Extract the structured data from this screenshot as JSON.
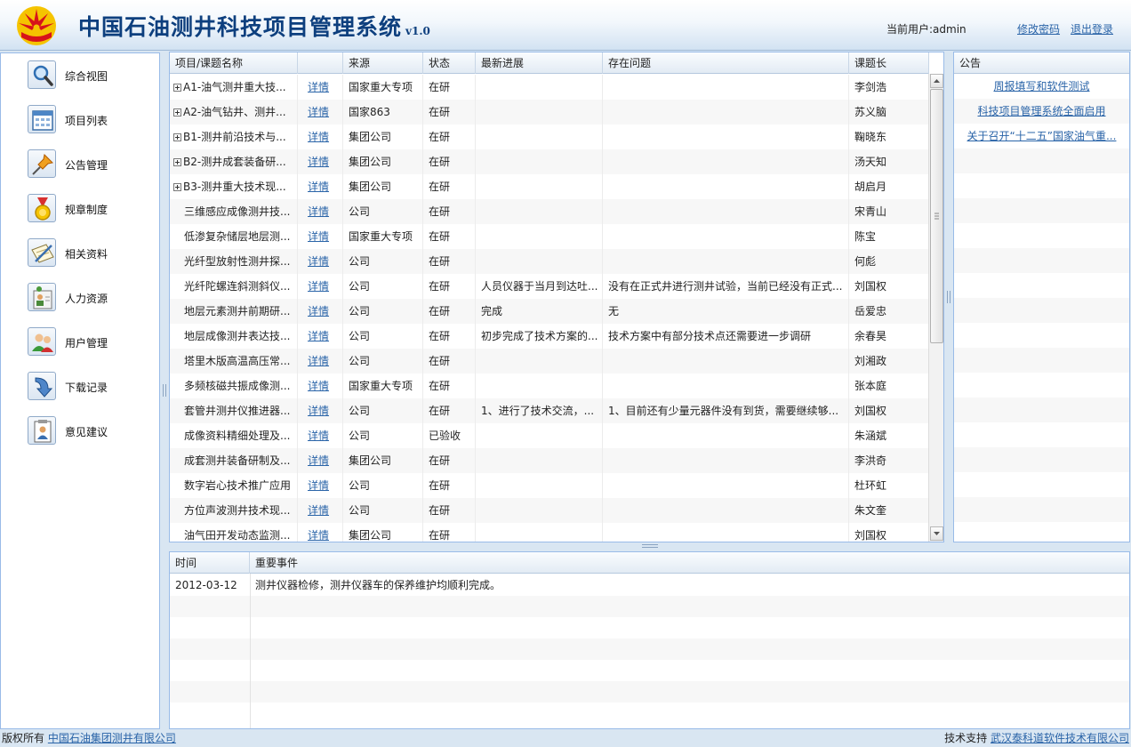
{
  "header": {
    "title": "中国石油测井科技项目管理系统",
    "version": "v1.0",
    "user_label": "当前用户:admin",
    "change_password": "修改密码",
    "logout": "退出登录"
  },
  "nav": [
    {
      "label": "综合视图",
      "icon": "magnifier-icon"
    },
    {
      "label": "项目列表",
      "icon": "calendar-icon"
    },
    {
      "label": "公告管理",
      "icon": "pushpin-icon"
    },
    {
      "label": "规章制度",
      "icon": "medal-icon"
    },
    {
      "label": "相关资料",
      "icon": "notebook-pen-icon"
    },
    {
      "label": "人力资源",
      "icon": "people-card-icon"
    },
    {
      "label": "用户管理",
      "icon": "users-icon"
    },
    {
      "label": "下载记录",
      "icon": "download-arrow-icon"
    },
    {
      "label": "意见建议",
      "icon": "feedback-icon"
    }
  ],
  "grid": {
    "columns": [
      "项目/课题名称",
      "",
      "来源",
      "状态",
      "最新进展",
      "存在问题",
      "课题长"
    ],
    "detail_label": "详情",
    "rows": [
      {
        "name": "A1-油气测井重大技...",
        "expandable": true,
        "source": "国家重大专项",
        "status": "在研",
        "progress": "",
        "issue": "",
        "leader": "李剑浩"
      },
      {
        "name": "A2-油气钻井、测井...",
        "expandable": true,
        "source": "国家863",
        "status": "在研",
        "progress": "",
        "issue": "",
        "leader": "苏义脑"
      },
      {
        "name": "B1-测井前沿技术与...",
        "expandable": true,
        "source": "集团公司",
        "status": "在研",
        "progress": "",
        "issue": "",
        "leader": "鞠晓东"
      },
      {
        "name": "B2-测井成套装备研...",
        "expandable": true,
        "source": "集团公司",
        "status": "在研",
        "progress": "",
        "issue": "",
        "leader": "汤天知"
      },
      {
        "name": "B3-测井重大技术现...",
        "expandable": true,
        "source": "集团公司",
        "status": "在研",
        "progress": "",
        "issue": "",
        "leader": "胡启月"
      },
      {
        "name": "三维感应成像测井技...",
        "expandable": false,
        "source": "公司",
        "status": "在研",
        "progress": "",
        "issue": "",
        "leader": "宋青山"
      },
      {
        "name": "低渗复杂储层地层测...",
        "expandable": false,
        "source": "国家重大专项",
        "status": "在研",
        "progress": "",
        "issue": "",
        "leader": "陈宝"
      },
      {
        "name": "光纤型放射性测井探...",
        "expandable": false,
        "source": "公司",
        "status": "在研",
        "progress": "",
        "issue": "",
        "leader": "何彪"
      },
      {
        "name": "光纤陀螺连斜测斜仪...",
        "expandable": false,
        "source": "公司",
        "status": "在研",
        "progress": "人员仪器于当月到达吐...",
        "issue": "没有在正式井进行测井试验，当前已经没有正式...",
        "leader": "刘国权"
      },
      {
        "name": "地层元素测井前期研...",
        "expandable": false,
        "source": "公司",
        "status": "在研",
        "progress": "完成",
        "issue": "无",
        "leader": "岳爱忠"
      },
      {
        "name": "地层成像测井表达技...",
        "expandable": false,
        "source": "公司",
        "status": "在研",
        "progress": "初步完成了技术方案的...",
        "issue": "技术方案中有部分技术点还需要进一步调研",
        "leader": "余春昊"
      },
      {
        "name": "塔里木版高温高压常...",
        "expandable": false,
        "source": "公司",
        "status": "在研",
        "progress": "",
        "issue": "",
        "leader": "刘湘政"
      },
      {
        "name": "多频核磁共振成像测...",
        "expandable": false,
        "source": "国家重大专项",
        "status": "在研",
        "progress": "",
        "issue": "",
        "leader": "张本庭"
      },
      {
        "name": "套管井测井仪推进器...",
        "expandable": false,
        "source": "公司",
        "status": "在研",
        "progress": "1、进行了技术交流，...",
        "issue": "1、目前还有少量元器件没有到货，需要继续够...",
        "leader": "刘国权"
      },
      {
        "name": "成像资料精细处理及...",
        "expandable": false,
        "source": "公司",
        "status": "已验收",
        "progress": "",
        "issue": "",
        "leader": "朱涵斌"
      },
      {
        "name": "成套测井装备研制及...",
        "expandable": false,
        "source": "集团公司",
        "status": "在研",
        "progress": "",
        "issue": "",
        "leader": "李洪奇"
      },
      {
        "name": "数字岩心技术推广应用",
        "expandable": false,
        "source": "公司",
        "status": "在研",
        "progress": "",
        "issue": "",
        "leader": "杜环虹"
      },
      {
        "name": "方位声波测井技术现...",
        "expandable": false,
        "source": "公司",
        "status": "在研",
        "progress": "",
        "issue": "",
        "leader": "朱文奎"
      },
      {
        "name": "油气田开发动态监测...",
        "expandable": false,
        "source": "集团公司",
        "status": "在研",
        "progress": "",
        "issue": "",
        "leader": "刘国权"
      }
    ]
  },
  "notice": {
    "title": "公告",
    "items": [
      "周报填写和软件测试",
      "科技项目管理系统全面启用",
      "关于召开“十二五”国家油气重..."
    ]
  },
  "events": {
    "columns": [
      "时间",
      "重要事件"
    ],
    "rows": [
      {
        "time": "2012-03-12",
        "event": "测井仪器检修，测井仪器车的保养维护均顺利完成。"
      }
    ]
  },
  "footer": {
    "copyright_label": "版权所有",
    "copyright_company": "中国石油集团测井有限公司",
    "support_label": "技术支持",
    "support_company": "武汉泰科道软件技术有限公司"
  },
  "colors": {
    "brand": "#0d3f7e",
    "link": "#2a64a8",
    "panel_border": "#99bbe8",
    "logo_red": "#d7141a",
    "logo_yellow": "#f5c400"
  }
}
